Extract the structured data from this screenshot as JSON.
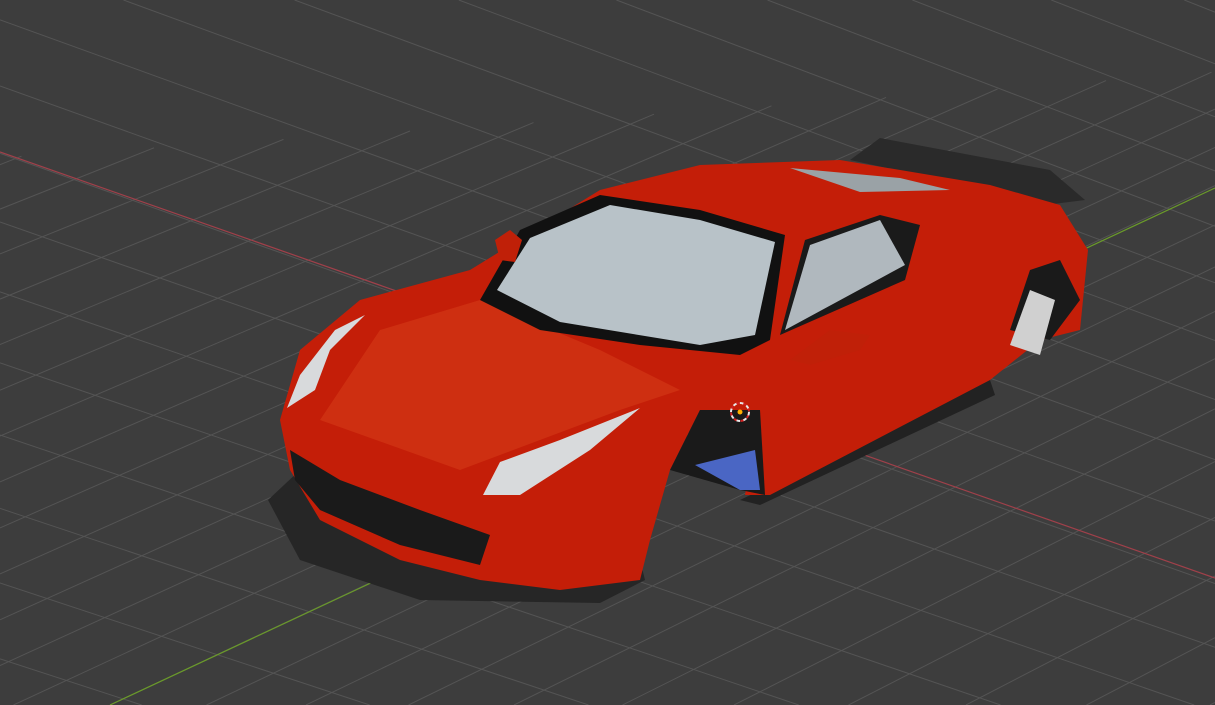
{
  "viewport": {
    "background": "#3d3d3d",
    "grid_color": "#545454",
    "x_axis_color": "#a0404a",
    "y_axis_color": "#6a9a2a"
  },
  "model": {
    "body_color": "#c41e08",
    "glass_color": "#b8c2c8",
    "trim_color": "#1e1e1e",
    "underside_color": "#4a66c4"
  },
  "cursor": {
    "icon": "3d-cursor-icon"
  }
}
